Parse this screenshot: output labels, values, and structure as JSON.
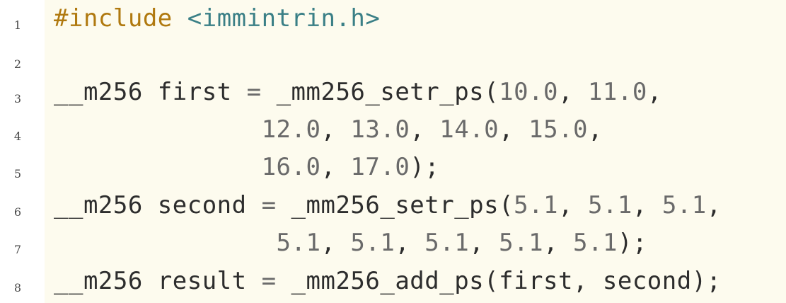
{
  "colors": {
    "code_background": "#fdfbee",
    "preprocessor": "#b0790f",
    "header_name": "#3a7f86",
    "text": "#2d2d2d",
    "number": "#6a6a6a"
  },
  "lines": [
    {
      "number": "1",
      "tokens": [
        {
          "t": "#include",
          "k": "pp"
        },
        {
          "t": " ",
          "k": "ty"
        },
        {
          "t": "<immintrin.h>",
          "k": "hdr"
        }
      ]
    },
    {
      "number": "2",
      "tokens": []
    },
    {
      "number": "3",
      "tokens": [
        {
          "t": "__m256 first ",
          "k": "ty"
        },
        {
          "t": "=",
          "k": "op"
        },
        {
          "t": " _mm256_setr_ps(",
          "k": "ty"
        },
        {
          "t": "10.0",
          "k": "num"
        },
        {
          "t": ", ",
          "k": "ty"
        },
        {
          "t": "11.0",
          "k": "num"
        },
        {
          "t": ",",
          "k": "ty"
        }
      ]
    },
    {
      "number": "4",
      "tokens": [
        {
          "t": "              ",
          "k": "ty"
        },
        {
          "t": "12.0",
          "k": "num"
        },
        {
          "t": ", ",
          "k": "ty"
        },
        {
          "t": "13.0",
          "k": "num"
        },
        {
          "t": ", ",
          "k": "ty"
        },
        {
          "t": "14.0",
          "k": "num"
        },
        {
          "t": ", ",
          "k": "ty"
        },
        {
          "t": "15.0",
          "k": "num"
        },
        {
          "t": ",",
          "k": "ty"
        }
      ]
    },
    {
      "number": "5",
      "tokens": [
        {
          "t": "              ",
          "k": "ty"
        },
        {
          "t": "16.0",
          "k": "num"
        },
        {
          "t": ", ",
          "k": "ty"
        },
        {
          "t": "17.0",
          "k": "num"
        },
        {
          "t": ");",
          "k": "ty"
        }
      ]
    },
    {
      "number": "6",
      "tokens": [
        {
          "t": "__m256 second ",
          "k": "ty"
        },
        {
          "t": "=",
          "k": "op"
        },
        {
          "t": " _mm256_setr_ps(",
          "k": "ty"
        },
        {
          "t": "5.1",
          "k": "num"
        },
        {
          "t": ", ",
          "k": "ty"
        },
        {
          "t": "5.1",
          "k": "num"
        },
        {
          "t": ", ",
          "k": "ty"
        },
        {
          "t": "5.1",
          "k": "num"
        },
        {
          "t": ",",
          "k": "ty"
        }
      ]
    },
    {
      "number": "7",
      "tokens": [
        {
          "t": "               ",
          "k": "ty"
        },
        {
          "t": "5.1",
          "k": "num"
        },
        {
          "t": ", ",
          "k": "ty"
        },
        {
          "t": "5.1",
          "k": "num"
        },
        {
          "t": ", ",
          "k": "ty"
        },
        {
          "t": "5.1",
          "k": "num"
        },
        {
          "t": ", ",
          "k": "ty"
        },
        {
          "t": "5.1",
          "k": "num"
        },
        {
          "t": ", ",
          "k": "ty"
        },
        {
          "t": "5.1",
          "k": "num"
        },
        {
          "t": ");",
          "k": "ty"
        }
      ]
    },
    {
      "number": "8",
      "tokens": [
        {
          "t": "__m256 result ",
          "k": "ty"
        },
        {
          "t": "=",
          "k": "op"
        },
        {
          "t": " _mm256_add_ps(first, second);",
          "k": "ty"
        }
      ]
    }
  ]
}
